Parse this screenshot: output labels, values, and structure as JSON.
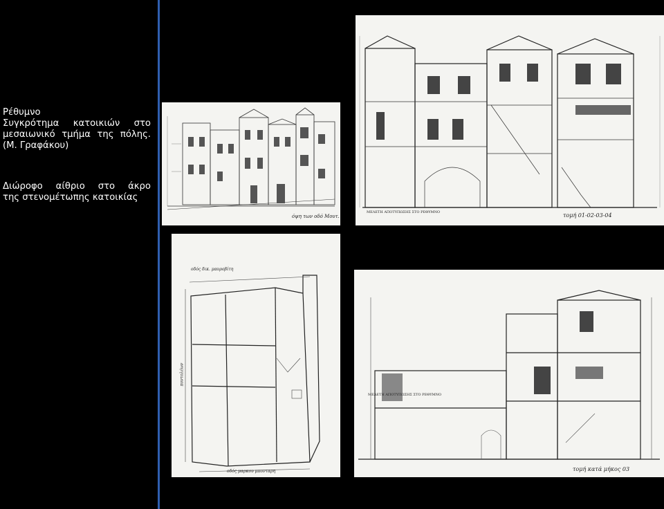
{
  "caption": {
    "lines": [
      "Ρέθυμνο",
      "Συγκρότημα κατοικιών στο",
      "μεσαιωνικό τμήμα της πόλης.",
      "(Μ. Γραφάκου)"
    ],
    "note_lines": [
      "Διώροφο αίθριο στο άκρο",
      "της στενομέτωπης κατοικίας"
    ]
  },
  "drawings": {
    "elevation": {
      "label": "όψη των οδό Μουτ."
    },
    "section_top": {
      "label": "τομή 01-02-03-04",
      "title_block": "ΜΕΛΕΤΗ ΑΠΟΤΥΠΩΣΗΣ ΣΤΟ ΡΕΘΥΜΝΟ"
    },
    "plan": {
      "street_top": "οδός δικ. μαυροβίτη",
      "street_bottom": "οδός μαρκου μπονταρη",
      "street_left": "ποντολέων"
    },
    "section_bottom": {
      "label": "τομή κατά μήκος 03",
      "title_block": "ΜΕΛΕΤΗ ΑΠΟΤΥΠΩΣΗΣ ΣΤΟ ΡΕΘΥΜΝΟ"
    }
  }
}
